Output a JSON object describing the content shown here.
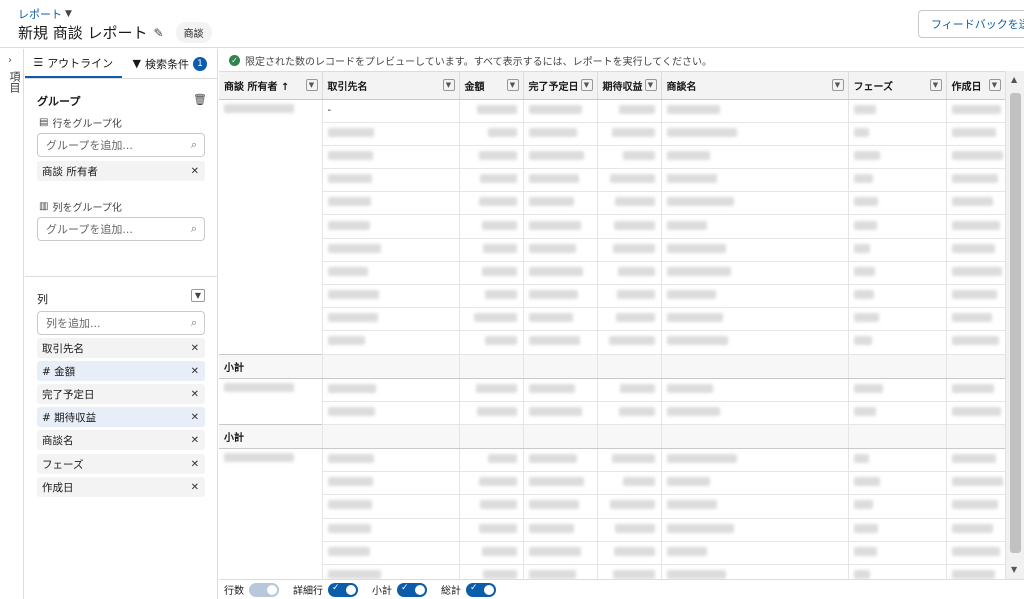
{
  "header": {
    "breadcrumb": "レポート",
    "title": "新規 商談 レポート",
    "object_badge": "商談",
    "feedback_button": "フィードバックを送信"
  },
  "rail": {
    "label": "項目"
  },
  "panel": {
    "tabs": {
      "outline": "アウトライン",
      "filters": "検索条件",
      "filter_count": "1"
    },
    "groups": {
      "title": "グループ",
      "row_group_label": "行をグループ化",
      "row_placeholder": "グループを追加...",
      "row_pill": "商談 所有者",
      "col_group_label": "列をグループ化",
      "col_placeholder": "グループを追加..."
    },
    "columns": {
      "title": "列",
      "placeholder": "列を追加...",
      "items": [
        "取引先名",
        "# 金額",
        "完了予定日",
        "# 期待収益",
        "商談名",
        "フェーズ",
        "作成日"
      ]
    }
  },
  "notice": "限定された数のレコードをプレビューしています。すべて表示するには、レポートを実行してください。",
  "table": {
    "headers": [
      "商談 所有者 ↑",
      "取引先名",
      "金額",
      "完了予定日",
      "期待収益",
      "商談名",
      "フェーズ",
      "作成日"
    ],
    "subtotal_label": "小計",
    "first_cell": "-"
  },
  "footer": {
    "row_count": "行数",
    "detail_rows": "詳細行",
    "subtotal": "小計",
    "grand_total": "総計"
  },
  "colors": {
    "accent": "#0b5cab",
    "success": "#2e844a"
  }
}
